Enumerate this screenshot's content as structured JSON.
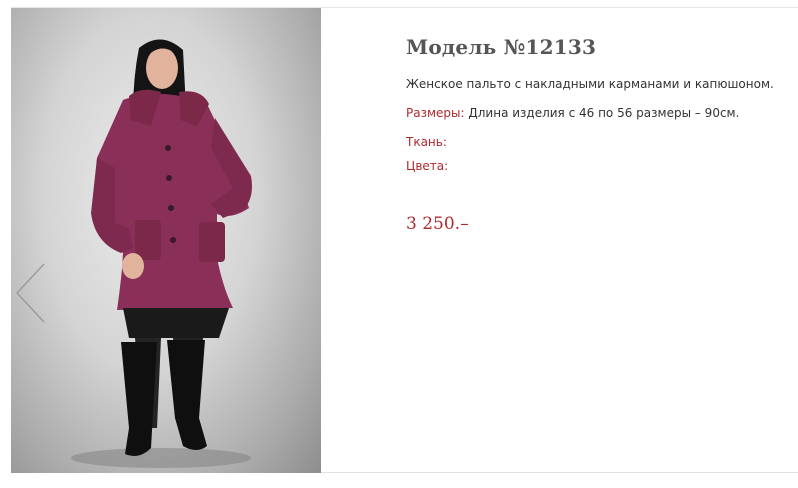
{
  "product": {
    "title": "Модель №12133",
    "description": "Женское пальто с накладными карманами и капюшоном.",
    "sizes_label": "Размеры:",
    "sizes_value": "Длина изделия с 46 по 56 размеры – 90см.",
    "fabric_label": "Ткань:",
    "fabric_value": "",
    "colors_label": "Цвета:",
    "colors_value": "",
    "price": "3 250.–"
  },
  "gallery": {
    "prev_icon": "chevron-left-icon"
  },
  "colors": {
    "accent": "#b0292f",
    "title": "#555555",
    "text": "#333333",
    "coat": "#8a2f57"
  }
}
